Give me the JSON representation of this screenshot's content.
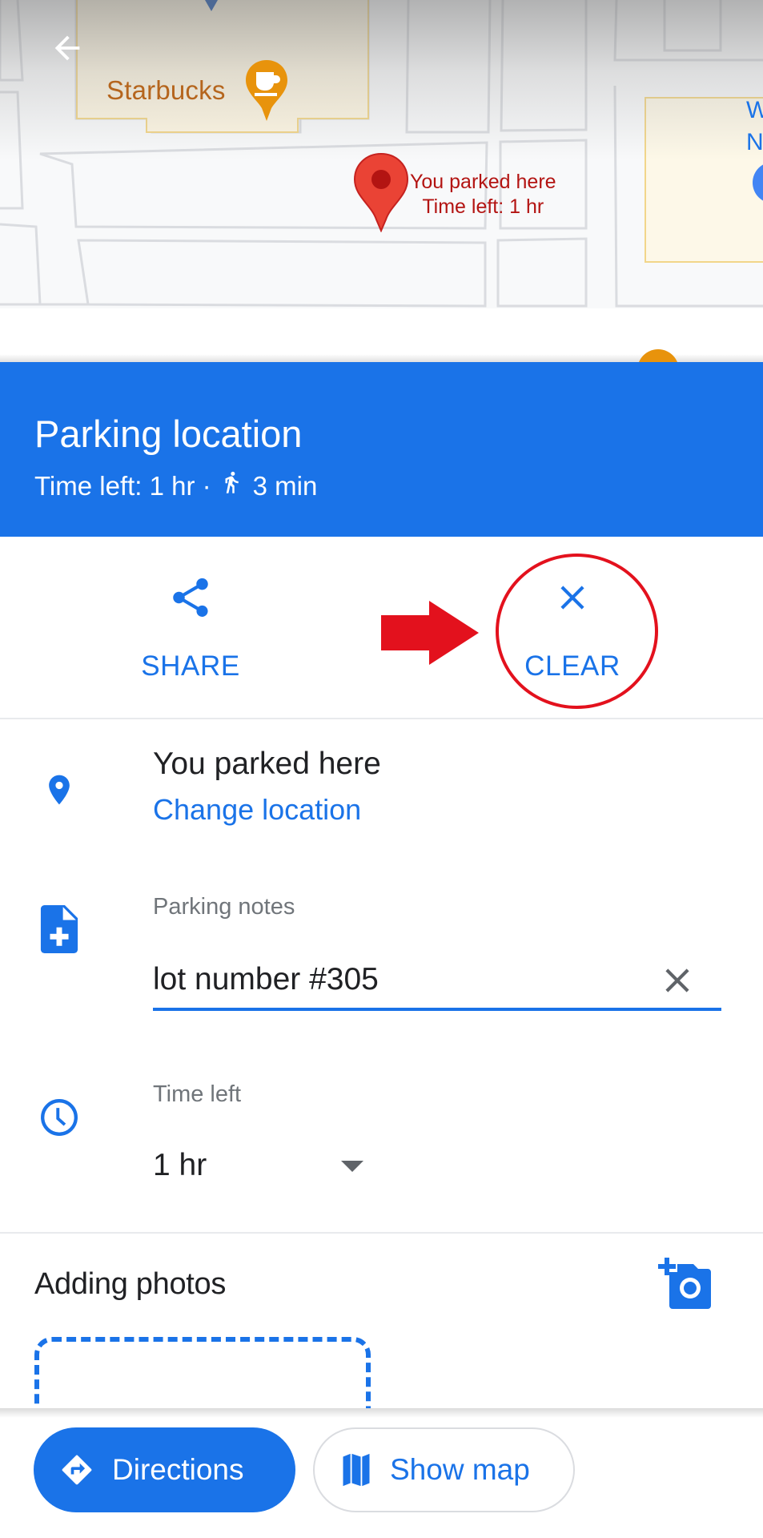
{
  "map": {
    "back_icon": "arrow-back-icon",
    "poi_starbucks": "Starbucks",
    "parked_marker": {
      "line1": "You parked here",
      "line2": "Time left: 1 hr"
    },
    "partial_label": {
      "line1": "W",
      "line2": "N"
    }
  },
  "header": {
    "title": "Parking location",
    "time_left": "Time left: 1 hr ·",
    "walk_icon": "directions-walk-icon",
    "walk_time": "3 min",
    "color": "#1a73e8"
  },
  "actions": [
    {
      "label": "SHARE",
      "icon": "share-icon"
    },
    {
      "label": "CLEAR",
      "icon": "close-icon"
    }
  ],
  "annotation": {
    "arrow_color": "#e3111d",
    "circle_color": "#e3111d",
    "highlighted": "CLEAR"
  },
  "location": {
    "icon": "place-icon",
    "title": "You parked here",
    "change_link": "Change location"
  },
  "notes": {
    "icon": "note-add-icon",
    "label": "Parking notes",
    "value": "lot number #305",
    "clear_icon": "close-icon"
  },
  "time_left": {
    "icon": "clock-icon",
    "label": "Time left",
    "selected": "1 hr",
    "caret_icon": "arrow-drop-down-icon"
  },
  "photos": {
    "title": "Adding photos",
    "add_icon": "add-a-photo-icon"
  },
  "bottom": {
    "directions_label": "Directions",
    "directions_icon": "directions-icon",
    "show_map_label": "Show map",
    "show_map_icon": "map-icon"
  },
  "colors": {
    "accent": "#1a73e8",
    "marker_red": "#ea4335",
    "marker_text": "#b31412",
    "poi_orange": "#e8930c"
  }
}
